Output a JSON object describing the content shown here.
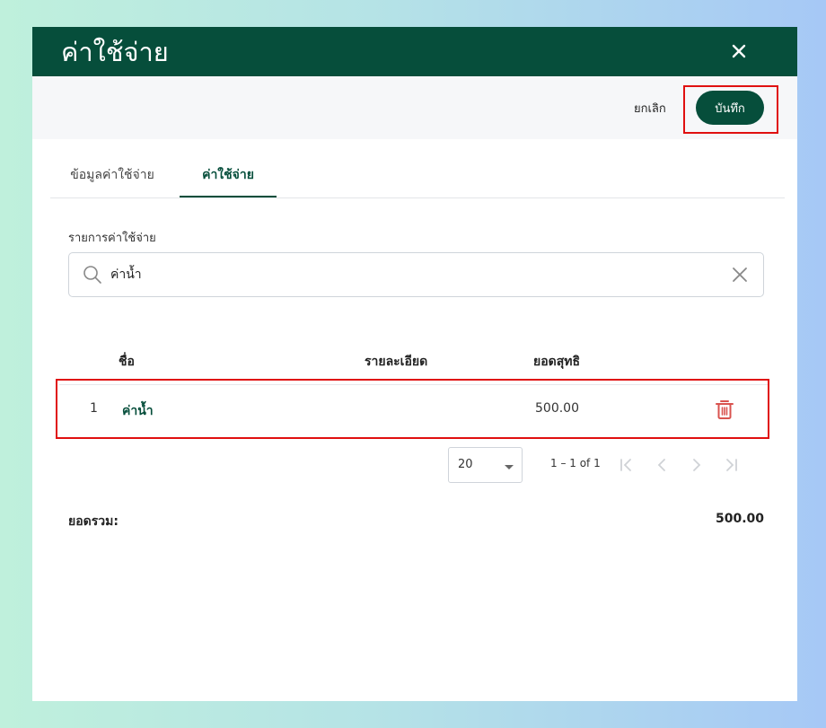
{
  "dialog": {
    "title": "ค่าใช้จ่าย",
    "close_icon": "close-icon"
  },
  "actions": {
    "cancel_label": "ยกเลิก",
    "save_label": "บันทึก"
  },
  "tabs": [
    {
      "label": "ข้อมูลค่าใช้จ่าย",
      "active": false
    },
    {
      "label": "ค่าใช้จ่าย",
      "active": true
    }
  ],
  "form": {
    "field_label": "รายการค่าใช้จ่าย",
    "search_value": "ค่าน้ำ",
    "search_icon": "search-icon",
    "clear_icon": "clear-icon"
  },
  "table": {
    "columns": [
      "ชื่อ",
      "รายละเอียด",
      "ยอดสุทธิ"
    ],
    "rows": [
      {
        "index": "1",
        "name": "ค่าน้ำ",
        "detail": "",
        "amount": "500.00"
      }
    ]
  },
  "pagination": {
    "page_size": "20",
    "range": "1 – 1 of 1"
  },
  "summary": {
    "total_label": "ยอดรวม:",
    "total_value": "500.00"
  },
  "colors": {
    "primary": "#064e3b",
    "highlight": "#e01010",
    "delete": "#d9534f"
  }
}
